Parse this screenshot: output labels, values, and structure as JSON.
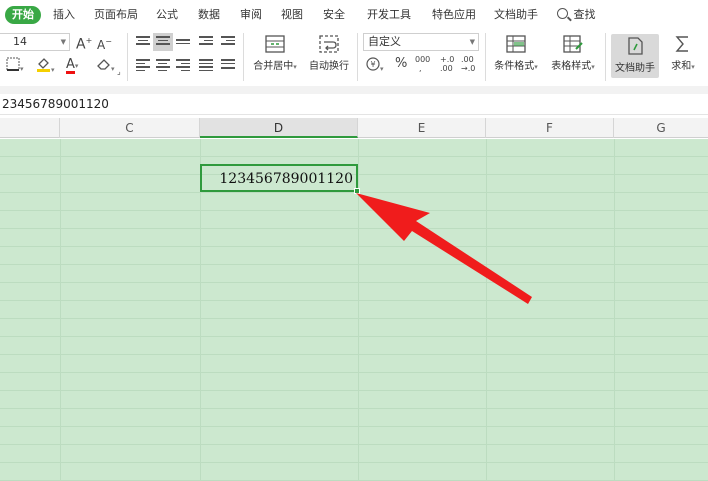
{
  "menu": {
    "items": [
      "开始",
      "插入",
      "页面布局",
      "公式",
      "数据",
      "审阅",
      "视图",
      "安全",
      "开发工具",
      "特色应用",
      "文档助手"
    ],
    "search": "查找"
  },
  "ribbon": {
    "font_size": "14",
    "grow_font": "A",
    "shrink_font": "A",
    "font_color_glyph": "A",
    "merge_label": "合并居中",
    "wrap_label": "自动换行",
    "number_format": "自定义",
    "percent": "%",
    "thousands": "000",
    "inc_decimal": "+.0\n.00",
    "dec_decimal": ".00\n→.0",
    "cond_format": "条件格式",
    "table_style": "表格样式",
    "doc_helper": "文档助手",
    "sum": "求和"
  },
  "formula_bar": {
    "value": "23456789001120"
  },
  "columns": [
    "C",
    "D",
    "E",
    "F",
    "G"
  ],
  "selected_column": "D",
  "cell": {
    "value": "123456789001120"
  },
  "colors": {
    "accent": "#39a845",
    "sheet_background": "#cce8cf",
    "arrow": "#f01c1c"
  }
}
